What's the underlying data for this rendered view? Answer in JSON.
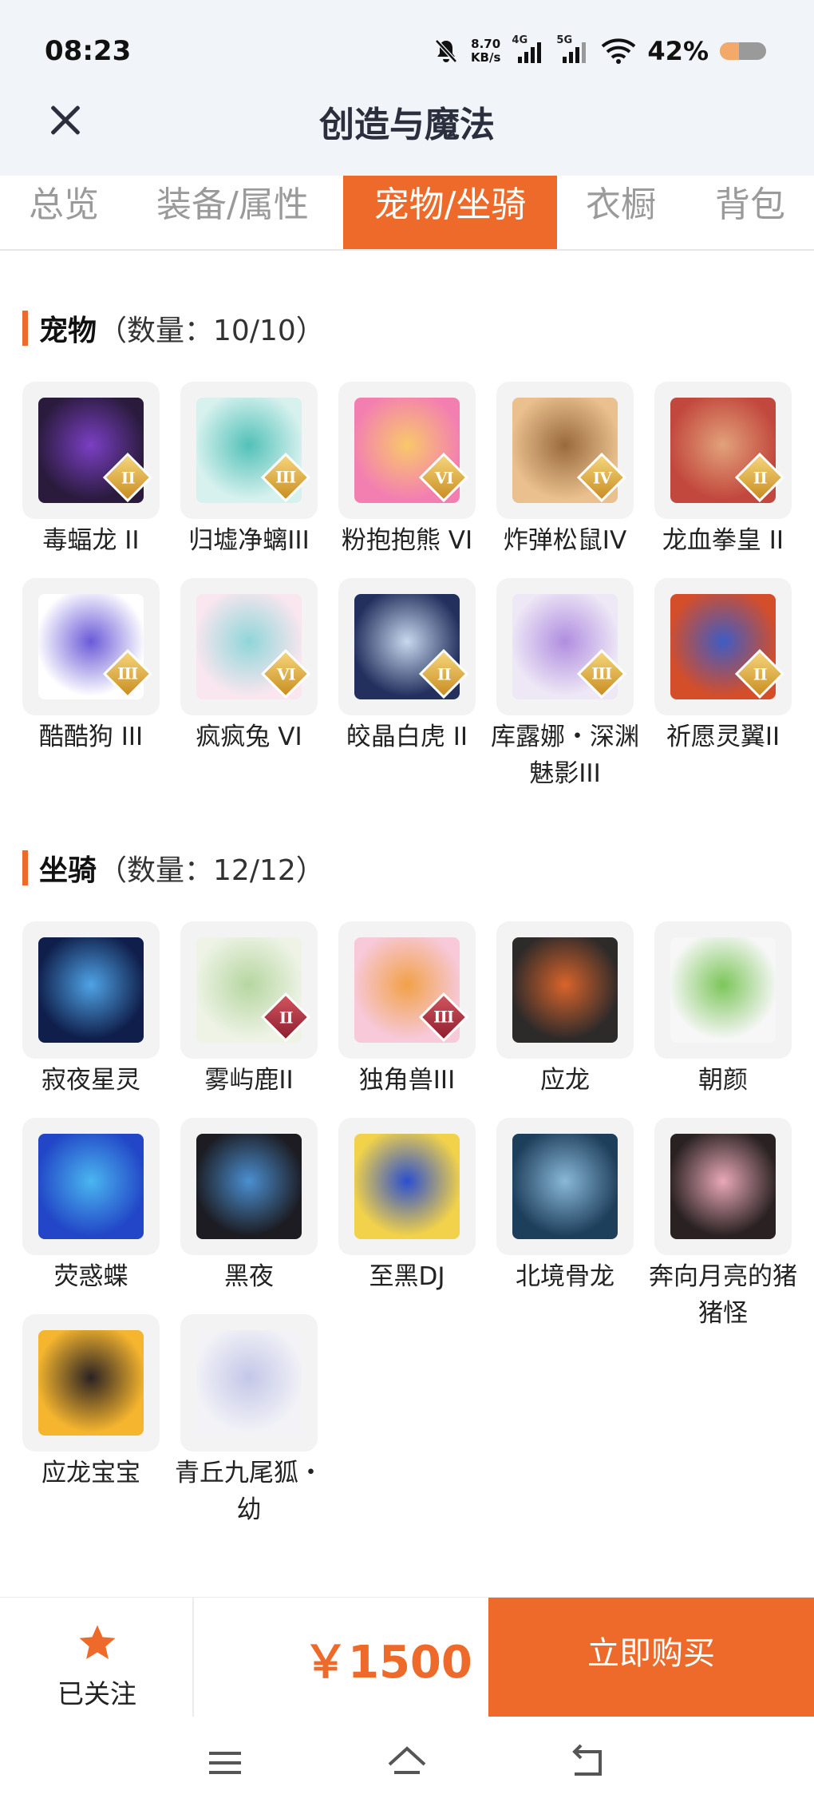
{
  "status_bar": {
    "time": "08:23",
    "net_speed_value": "8.70",
    "net_speed_unit": "KB/s",
    "signal_1": "4G",
    "signal_2": "5G",
    "battery_percent": "42%",
    "battery_level": 0.42,
    "icons": [
      "mute-bell-icon",
      "signal-4g-icon",
      "signal-5g-icon",
      "wifi-icon",
      "battery-icon"
    ]
  },
  "header": {
    "title": "创造与魔法",
    "close_icon": "close-icon"
  },
  "tabs": [
    {
      "label": "总览",
      "active": false
    },
    {
      "label": "装备/属性",
      "active": false
    },
    {
      "label": "宠物/坐骑",
      "active": true
    },
    {
      "label": "衣橱",
      "active": false
    },
    {
      "label": "背包",
      "active": false
    }
  ],
  "pets": {
    "title": "宠物",
    "count": "（数量：10/10）",
    "items": [
      {
        "name": "毒蝠龙 II",
        "tier": "II",
        "colors": [
          "#2a1b3d",
          "#7b3fc4"
        ]
      },
      {
        "name": "归墟净螭III",
        "tier": "III",
        "colors": [
          "#d7f1ee",
          "#52c1b8"
        ]
      },
      {
        "name": "粉抱抱熊 VI",
        "tier": "VI",
        "colors": [
          "#f37fb1",
          "#f9c86a"
        ]
      },
      {
        "name": "炸弹松鼠IV",
        "tier": "IV",
        "colors": [
          "#e9c08e",
          "#9a6a3c"
        ]
      },
      {
        "name": "龙血拳皇 II",
        "tier": "II",
        "colors": [
          "#c2473d",
          "#e2a27a"
        ]
      },
      {
        "name": "酷酷狗 III",
        "tier": "III",
        "colors": [
          "#ffffff",
          "#6a5ad8"
        ]
      },
      {
        "name": "疯疯兔 VI",
        "tier": "VI",
        "colors": [
          "#f9e6ef",
          "#8fd6d9"
        ]
      },
      {
        "name": "皎晶白虎 II",
        "tier": "II",
        "colors": [
          "#23305e",
          "#c8d8ee"
        ]
      },
      {
        "name": "库露娜・深渊魅影III",
        "tier": "III",
        "colors": [
          "#eee8f6",
          "#b08de0"
        ]
      },
      {
        "name": "祈愿灵翼II",
        "tier": "II",
        "colors": [
          "#d44e2a",
          "#3e5cc4"
        ]
      }
    ]
  },
  "mounts": {
    "title": "坐骑",
    "count": "（数量：12/12）",
    "items": [
      {
        "name": "寂夜星灵",
        "tier": "",
        "colors": [
          "#0f1e4a",
          "#4fa3e6"
        ]
      },
      {
        "name": "雾屿鹿II",
        "tier": "II",
        "colors": [
          "#eef3e6",
          "#b6d6a0"
        ]
      },
      {
        "name": "独角兽III",
        "tier": "III",
        "colors": [
          "#f7c9d9",
          "#f2a148"
        ]
      },
      {
        "name": "应龙",
        "tier": "",
        "colors": [
          "#2d2a2a",
          "#d9642b"
        ]
      },
      {
        "name": "朝颜",
        "tier": "",
        "colors": [
          "#f7f7f7",
          "#7cc65a"
        ]
      },
      {
        "name": "荧惑蝶",
        "tier": "",
        "colors": [
          "#2246c7",
          "#4ab6f0"
        ]
      },
      {
        "name": "黑夜",
        "tier": "",
        "colors": [
          "#1c1c22",
          "#4b8fd1"
        ]
      },
      {
        "name": "至黑DJ",
        "tier": "",
        "colors": [
          "#f1d24a",
          "#2b4fcf"
        ]
      },
      {
        "name": "北境骨龙",
        "tier": "",
        "colors": [
          "#1e3f5c",
          "#8ab8d8"
        ]
      },
      {
        "name": "奔向月亮的猪猪怪",
        "tier": "",
        "colors": [
          "#2a2222",
          "#e9a8b7"
        ]
      },
      {
        "name": "应龙宝宝",
        "tier": "",
        "colors": [
          "#f5b52e",
          "#2b2222"
        ]
      },
      {
        "name": "青丘九尾狐・幼",
        "tier": "",
        "colors": [
          "#f2f2f7",
          "#c4c7e8"
        ]
      }
    ]
  },
  "bottom_bar": {
    "follow_label": "已关注",
    "follow_icon": "star-icon",
    "price": "￥1500",
    "buy_label": "立即购买"
  },
  "nav_bar": {
    "icons": [
      "menu-icon",
      "home-icon",
      "back-icon"
    ]
  },
  "accent_color": "#ee6a2b"
}
